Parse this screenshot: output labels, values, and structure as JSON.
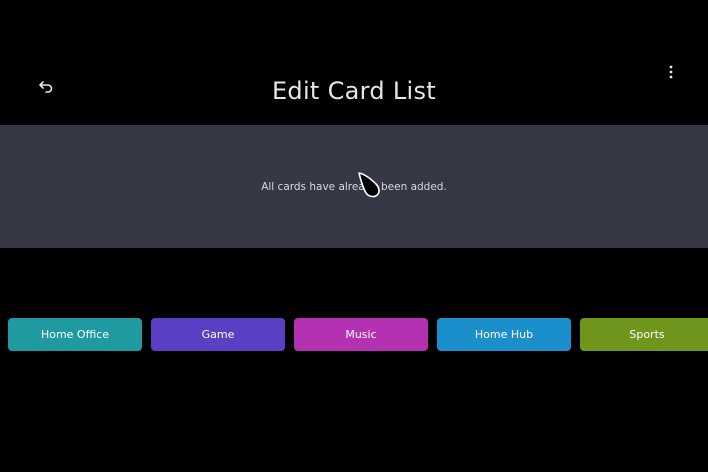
{
  "header": {
    "title": "Edit Card List",
    "back_icon": "back-arrow-icon",
    "more_icon": "more-vertical-icon"
  },
  "empty_state": {
    "message": "All cards have already been added."
  },
  "cards": [
    {
      "label": "Home Office",
      "color": "#1e9aa0"
    },
    {
      "label": "Game",
      "color": "#5a3fc4"
    },
    {
      "label": "Music",
      "color": "#b431b2"
    },
    {
      "label": "Home Hub",
      "color": "#1a8fcc"
    },
    {
      "label": "Sports",
      "color": "#6e951c"
    }
  ],
  "colors": {
    "background": "#000000",
    "panel": "#353744",
    "title_text": "#e6e6e6"
  }
}
